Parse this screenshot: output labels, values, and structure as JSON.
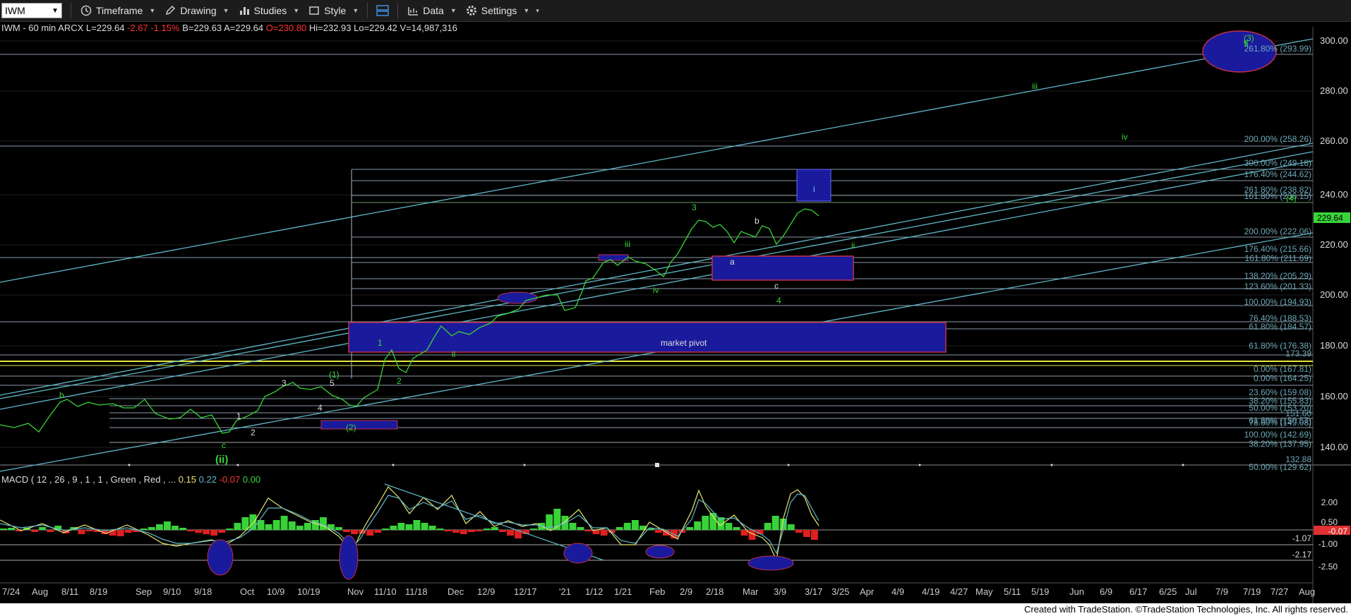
{
  "toolbar": {
    "symbol": "IWM",
    "timeframe": "Timeframe",
    "drawing": "Drawing",
    "studies": "Studies",
    "style": "Style",
    "data": "Data",
    "settings": "Settings"
  },
  "info": {
    "header": "IWM - 60 min  ARCX  L=229.64",
    "change": "-2.67 -1.15%",
    "bid": "B=229.63 A=229.64",
    "open": "O=230.80",
    "rest": "Hi=232.93 Lo=229.42 V=14,987,316"
  },
  "macd_info": {
    "label": "MACD ( 12 , 26 , 9 , 1 , 1 , Green , Red , ... ",
    "v1": "0.15",
    "v2": "0.22",
    "v3": "-0.07",
    "v4": "0.00"
  },
  "price_badge": "229.64",
  "market_pivot": "market pivot",
  "footer": "Created with TradeStation. ©TradeStation Technologies, Inc. All rights reserved.",
  "colors": {
    "price": "#39d339",
    "fib": "#6ea8b8",
    "box": "#1a1a9c",
    "pivot_border": "#c0304a"
  },
  "y_axis": [
    "300.00",
    "280.00",
    "260.00",
    "240.00",
    "220.00",
    "200.00",
    "180.00",
    "160.00",
    "140.00"
  ],
  "macd_axis": [
    "2.00",
    "0.50",
    "-0.07",
    "-1.07",
    "-1.00",
    "-2.17",
    "-2.50"
  ],
  "x_axis": [
    "7/24",
    "Aug",
    "8/11",
    "8/19",
    "Sep",
    "9/10",
    "9/18",
    "Oct",
    "10/9",
    "10/19",
    "Nov",
    "11/10",
    "11/18",
    "Dec",
    "12/9",
    "12/17",
    "'21",
    "1/12",
    "1/21",
    "Feb",
    "2/9",
    "2/18",
    "Mar",
    "3/9",
    "3/17",
    "3/25",
    "Apr",
    "4/9",
    "4/19",
    "4/27",
    "May",
    "5/11",
    "5/19",
    "Jun",
    "6/9",
    "6/17",
    "6/25",
    "Jul",
    "7/9",
    "7/19",
    "7/27",
    "Aug"
  ],
  "fib_labels": [
    "261.80% (293.99)",
    "200.00% (258.26)",
    "300.00% (249.18)",
    "176.40% (244.62)",
    "261.80% (238.82)",
    "161.80% (236.15)",
    "200.00% (222.06)",
    "176.40% (215.66)",
    "161.80% (211.69)",
    "138.20% (205.29)",
    "123.60% (201.33)",
    "100.00% (194.93)",
    "76.40% (188.53)",
    "61.80% (184.57)",
    "61.80% (176.38)",
    "173.39",
    "0.00% (167.81)",
    "0.00% (164.25)",
    "23.60% (159.08)",
    "38.20% (155.83)",
    "50.00% (153.20)",
    "151.60",
    "61.80% (150.57)",
    "78.60% (149.08)",
    "100.00% (142.69)",
    "38.20% (137.95)",
    "132.88",
    "50.00% (129.62)"
  ],
  "wave_labels": [
    {
      "t": "(3)",
      "c": "#39d339"
    },
    {
      "t": "5",
      "c": "#39d339"
    },
    {
      "t": "v",
      "c": "#39d339"
    },
    {
      "t": "iii",
      "c": "#39d339"
    },
    {
      "t": "iv",
      "c": "#39d339"
    },
    {
      "t": "i",
      "c": "#6ec8ff"
    },
    {
      "t": "(4)",
      "c": "#39d339"
    },
    {
      "t": "ii",
      "c": "#39d339"
    },
    {
      "t": "3",
      "c": "#39d339"
    },
    {
      "t": "b",
      "c": "#ddd"
    },
    {
      "t": "a",
      "c": "#ddd"
    },
    {
      "t": "c",
      "c": "#ddd"
    },
    {
      "t": "4",
      "c": "#39d339"
    },
    {
      "t": "iii",
      "c": "#39d339"
    },
    {
      "t": "iv",
      "c": "#39d339"
    },
    {
      "t": "1",
      "c": "#39d339"
    },
    {
      "t": "ii",
      "c": "#39d339"
    },
    {
      "t": "2",
      "c": "#39d339"
    },
    {
      "t": "b",
      "c": "#39d339"
    },
    {
      "t": "3",
      "c": "#ddd"
    },
    {
      "t": "(1)",
      "c": "#39d339"
    },
    {
      "t": "5",
      "c": "#ddd"
    },
    {
      "t": "4",
      "c": "#ddd"
    },
    {
      "t": "1",
      "c": "#ddd"
    },
    {
      "t": "2",
      "c": "#ddd"
    },
    {
      "t": "(2)",
      "c": "#39d339"
    },
    {
      "t": "c",
      "c": "#39d339"
    },
    {
      "t": "(ii)",
      "c": "#39d339"
    }
  ]
}
